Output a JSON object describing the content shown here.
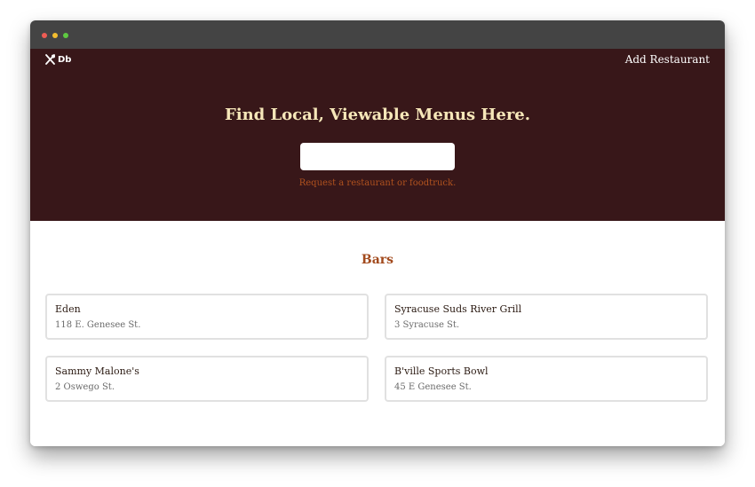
{
  "window": {
    "controls": [
      "close",
      "minimize",
      "zoom"
    ]
  },
  "header": {
    "logo_text": "Db",
    "logo_icon": "crossed-utensils-icon",
    "add_restaurant_label": "Add Restaurant"
  },
  "hero": {
    "title": "Find Local, Viewable Menus Here.",
    "search_value": "",
    "search_placeholder": "",
    "request_link": "Request a restaurant or foodtruck."
  },
  "section": {
    "title": "Bars",
    "items": [
      {
        "name": "Eden",
        "address": "118 E. Genesee St."
      },
      {
        "name": "Syracuse Suds River Grill",
        "address": "3 Syracuse St."
      },
      {
        "name": "Sammy Malone's",
        "address": "2 Oswego St."
      },
      {
        "name": "B'ville Sports Bowl",
        "address": "45 E Genesee St."
      }
    ]
  },
  "colors": {
    "hero_background": "#381719",
    "hero_title": "#f6e7b9",
    "accent": "#a24a1d",
    "request_link": "#b0521e"
  }
}
